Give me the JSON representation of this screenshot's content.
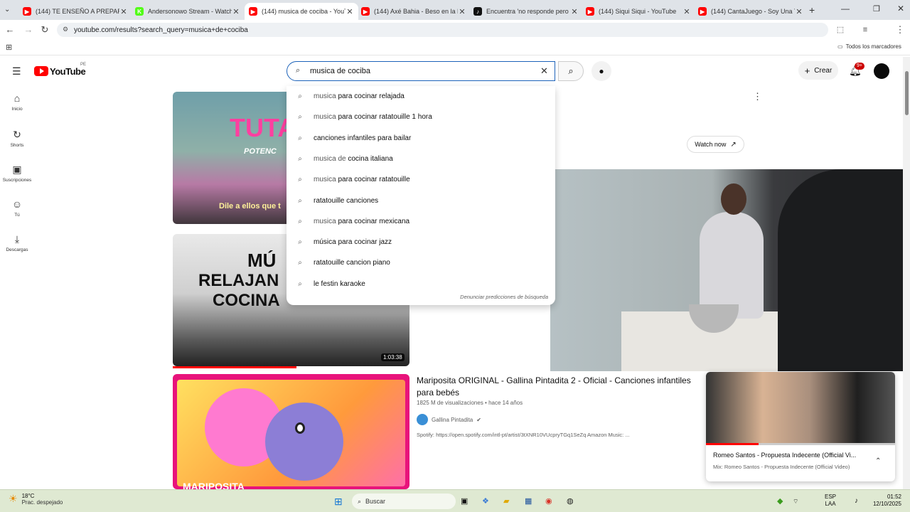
{
  "browser": {
    "tabs": [
      {
        "title": "(144) TE ENSEÑO A PREPARAR",
        "fav_color": "#ff0000",
        "fav": "▶",
        "active": false
      },
      {
        "title": "Andersonowo Stream - Watch L",
        "fav_color": "#53fc18",
        "fav": "K",
        "active": false
      },
      {
        "title": "(144) musica de cociba - YouTu",
        "fav_color": "#ff0000",
        "fav": "▶",
        "active": true
      },
      {
        "title": "(144) Axé Bahia - Beso en la bo",
        "fav_color": "#ff0000",
        "fav": "▶",
        "active": false
      },
      {
        "title": "Encuentra 'no responde pero s",
        "fav_color": "#111111",
        "fav": "♪",
        "active": false
      },
      {
        "title": "(144) Siqui Siqui - YouTube",
        "fav_color": "#ff0000",
        "fav": "▶",
        "active": false
      },
      {
        "title": "(144) CantaJuego - Soy Una Ta",
        "fav_color": "#ff0000",
        "fav": "▶",
        "active": false
      }
    ],
    "url": "youtube.com/results?search_query=musica+de+cociba",
    "bookmarks_all": "Todos los marcadores"
  },
  "youtube": {
    "logo_text": "YouTube",
    "logo_region": "PE",
    "search_value": "musica de cociba",
    "create_label": "Crear",
    "notif_count": "9+",
    "sidebar": [
      {
        "icon": "home-icon",
        "glyph": "⌂",
        "label": "Inicio"
      },
      {
        "icon": "shorts-icon",
        "glyph": "↻",
        "label": "Shorts"
      },
      {
        "icon": "subscriptions-icon",
        "glyph": "▣",
        "label": "Suscripciones"
      },
      {
        "icon": "you-icon",
        "glyph": "☺",
        "label": "Tú"
      },
      {
        "icon": "downloads-icon",
        "glyph": "⤓",
        "label": "Descargas"
      }
    ],
    "suggestions": [
      {
        "typed": "musica",
        "completion": " para cocinar relajada"
      },
      {
        "typed": "musica",
        "completion": " para cocinar ratatouille 1 hora"
      },
      {
        "typed": "",
        "completion": "canciones infantiles para bailar"
      },
      {
        "typed": "musica de",
        "completion": " cocina italiana"
      },
      {
        "typed": "musica",
        "completion": " para cocinar ratatouille"
      },
      {
        "typed": "",
        "completion": "ratatouille canciones"
      },
      {
        "typed": "musica",
        "completion": " para cocinar mexicana"
      },
      {
        "typed": "",
        "completion": "música para cocinar jazz"
      },
      {
        "typed": "",
        "completion": "ratatouille cancion piano"
      },
      {
        "typed": "",
        "completion": "le festin karaoke"
      }
    ],
    "report_predictions": "Denunciar predicciones de búsqueda",
    "watch_now": "Watch now",
    "thumb1_text": "TUTA",
    "thumb1_sub": "POTENC",
    "thumb1_caption": "Dile a ellos que t",
    "thumb2_line1": "MÚ",
    "thumb2_line2": "RELAJAN",
    "thumb2_line3": "COCINA",
    "thumb2_duration": "1:03:38",
    "thumb3_text": "MARIPOSITA",
    "result": {
      "title": "Mariposita ORIGINAL - Gallina Pintadita 2 - Oficial - Canciones infantiles para bebés",
      "meta": "1825 M de visualizaciones • hace 14 años",
      "channel": "Gallina Pintadita",
      "description": "Spotify: https://open.spotify.com/intl-pt/artist/3tXNR10VUcpryTGq1SeZq Amazon Music: ..."
    },
    "miniplayer": {
      "title": "Romeo Santos - Propuesta Indecente (Official Vi...",
      "subtitle": "Mix: Romeo Santos - Propuesta Indecente (Official Video)",
      "progress": 0.28
    }
  },
  "taskbar": {
    "weather_temp": "18°C",
    "weather_desc": "Prac. despejado",
    "search_label": "Buscar",
    "lang1": "ESP",
    "lang2": "LAA",
    "time": "01:52",
    "date": "12/10/2025"
  }
}
